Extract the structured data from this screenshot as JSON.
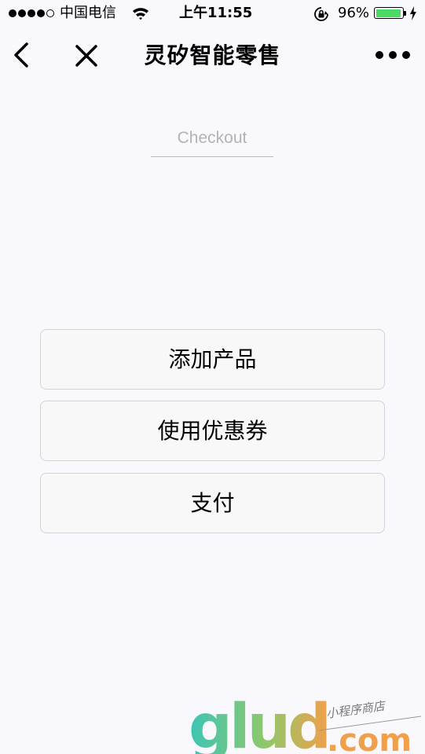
{
  "status_bar": {
    "carrier": "中国电信",
    "time": "上午11:55",
    "battery_percent": "96%",
    "battery_level": 0.96,
    "signal_strength_bars": 4,
    "signal_total_bars": 5,
    "colors": {
      "battery": "#4cd964"
    }
  },
  "nav": {
    "title": "灵矽智能零售",
    "back_icon": "chevron-left-icon",
    "close_icon": "close-icon",
    "more_icon": "more-dots-icon"
  },
  "checkout": {
    "placeholder": "Checkout",
    "value": ""
  },
  "actions": {
    "add_product": "添加产品",
    "use_coupon": "使用优惠券",
    "pay": "支付"
  },
  "watermark": {
    "brand": "glud",
    "domain": ".com",
    "tagline": "小程序商店",
    "colors": {
      "start": "#3cc5b5",
      "end": "#f0a04b"
    }
  }
}
